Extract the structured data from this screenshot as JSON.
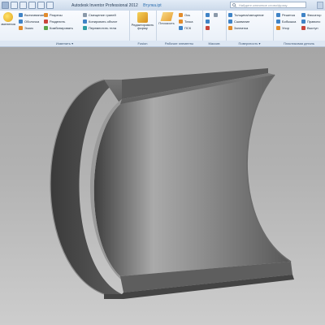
{
  "window": {
    "app_title": "Autodesk Inventor Professional 2012",
    "document_name": "Втулка.ipt",
    "search_placeholder": "Найдите ключевое слово/фразу"
  },
  "ribbon": {
    "modify_panel": {
      "label": "Изменить",
      "partial_button": "зменения",
      "items": [
        "Вытягивание",
        "Оболочка",
        "Эскиз",
        "Разрезы",
        "Разделить",
        "Комбинировать",
        "Смещение граней",
        "Копировать объект",
        "Переместить тела"
      ]
    },
    "fusion_panel": {
      "label": "Fusion",
      "button": "Редактировать форму"
    },
    "work_features_panel": {
      "label": "Рабочие элементы",
      "plane": "Плоскость",
      "axis": "Ось",
      "point": "Точка",
      "ucs": "ПСК"
    },
    "array_panel": {
      "label": "Массив"
    },
    "surface_panel": {
      "label": "Поверхность",
      "items": [
        "Толщина/смещение",
        "Сшивание",
        "Заплатка"
      ]
    },
    "plastic_panel": {
      "label": "Пластиковая деталь",
      "items": [
        "Решетка",
        "Бобышка",
        "Упор",
        "Фиксатор",
        "Правило",
        "Выступ"
      ]
    }
  },
  "colors": {
    "viewport_top": "#a6a6a6",
    "viewport_bottom": "#cdcdcd",
    "part_dark": "#4b4b4b",
    "part_light": "#a9a9a9"
  }
}
